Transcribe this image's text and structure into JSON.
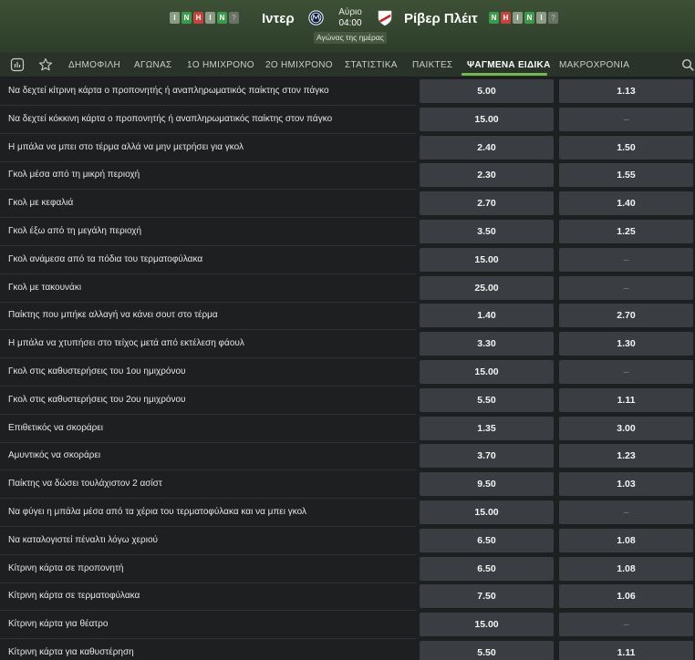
{
  "match": {
    "home": {
      "name": "Ιντερ",
      "form": [
        {
          "r": "Ι",
          "k": "D"
        },
        {
          "r": "Ν",
          "k": "W"
        },
        {
          "r": "Η",
          "k": "L"
        },
        {
          "r": "Ι",
          "k": "D"
        },
        {
          "r": "Ν",
          "k": "W"
        },
        {
          "r": "?",
          "k": "Q"
        }
      ]
    },
    "away": {
      "name": "Ρίβερ Πλέιτ",
      "form": [
        {
          "r": "Ν",
          "k": "W"
        },
        {
          "r": "Η",
          "k": "L"
        },
        {
          "r": "Ι",
          "k": "D"
        },
        {
          "r": "Ν",
          "k": "W"
        },
        {
          "r": "Ι",
          "k": "D"
        },
        {
          "r": "?",
          "k": "Q"
        }
      ]
    },
    "day": "Αύριο",
    "time": "04:00",
    "badge": "Αγώνας της ημέρας"
  },
  "nav": {
    "tabs": [
      "ΔΗΜΟΦΙΛΗ",
      "ΑΓΩΝΑΣ",
      "1Ο ΗΜΙΧΡΟΝΟ",
      "2Ο ΗΜΙΧΡΟΝΟ",
      "ΣΤΑΤΙΣΤΙΚΑ",
      "ΠΑΙΚΤΕΣ",
      "ΨΑΓΜΕΝΑ ΕΙΔΙΚΑ",
      "ΜΑΚΡΟΧΡΟΝΙΑ"
    ],
    "active_tab": "ΨΑΓΜΕΝΑ ΕΙΔΙΚΑ",
    "icons": [
      "stats-icon",
      "star-icon",
      "search-icon"
    ]
  },
  "markets": [
    {
      "label": "Να δεχτεί κίτρινη κάρτα ο προπονητής ή αναπληρωματικός παίκτης στον πάγκο",
      "yes": "5.00",
      "no": "1.13"
    },
    {
      "label": "Να δεχτεί κόκκινη κάρτα ο προπονητής ή αναπληρωματικός παίκτης στον πάγκο",
      "yes": "15.00",
      "no": "–"
    },
    {
      "label": "Η μπάλα να μπει στο τέρμα αλλά να μην μετρήσει για γκολ",
      "yes": "2.40",
      "no": "1.50"
    },
    {
      "label": "Γκολ μέσα από τη μικρή περιοχή",
      "yes": "2.30",
      "no": "1.55"
    },
    {
      "label": "Γκολ με κεφαλιά",
      "yes": "2.70",
      "no": "1.40"
    },
    {
      "label": "Γκολ έξω από τη μεγάλη περιοχή",
      "yes": "3.50",
      "no": "1.25"
    },
    {
      "label": "Γκολ ανάμεσα από τα πόδια του τερματοφύλακα",
      "yes": "15.00",
      "no": "–"
    },
    {
      "label": "Γκολ με τακουνάκι",
      "yes": "25.00",
      "no": "–"
    },
    {
      "label": "Παίκτης που μπήκε αλλαγή να κάνει σουτ στο τέρμα",
      "yes": "1.40",
      "no": "2.70"
    },
    {
      "label": "Η μπάλα να χτυπήσει στο τείχος μετά από εκτέλεση φάουλ",
      "yes": "3.30",
      "no": "1.30"
    },
    {
      "label": "Γκολ στις καθυστερήσεις του 1ου ημιχρόνου",
      "yes": "15.00",
      "no": "–"
    },
    {
      "label": "Γκολ στις καθυστερήσεις του 2ου ημιχρόνου",
      "yes": "5.50",
      "no": "1.11"
    },
    {
      "label": "Επιθετικός να σκοράρει",
      "yes": "1.35",
      "no": "3.00"
    },
    {
      "label": "Αμυντικός να σκοράρει",
      "yes": "3.70",
      "no": "1.23"
    },
    {
      "label": "Παίκτης να δώσει τουλάχιστον 2 ασίστ",
      "yes": "9.50",
      "no": "1.03"
    },
    {
      "label": "Να φύγει η μπάλα μέσα από τα χέρια του τερματοφύλακα και να μπει γκολ",
      "yes": "15.00",
      "no": "–"
    },
    {
      "label": "Να καταλογιστεί πέναλτι λόγω χεριού",
      "yes": "6.50",
      "no": "1.08"
    },
    {
      "label": "Κίτρινη κάρτα σε προπονητή",
      "yes": "6.50",
      "no": "1.08"
    },
    {
      "label": "Κίτρινη κάρτα σε τερματοφύλακα",
      "yes": "7.50",
      "no": "1.06"
    },
    {
      "label": "Κίτρινη κάρτα για θέατρο",
      "yes": "15.00",
      "no": "–"
    },
    {
      "label": "Κίτρινη κάρτα για καθυστέρηση",
      "yes": "5.50",
      "no": "1.11"
    }
  ],
  "colors": {
    "accent": "#71b94c",
    "form_win": "#3c9a4c",
    "form_loss": "#c9413a",
    "form_draw": "#8c9b86",
    "odds_button": "#3a3d41",
    "background": "#1d1f21"
  }
}
